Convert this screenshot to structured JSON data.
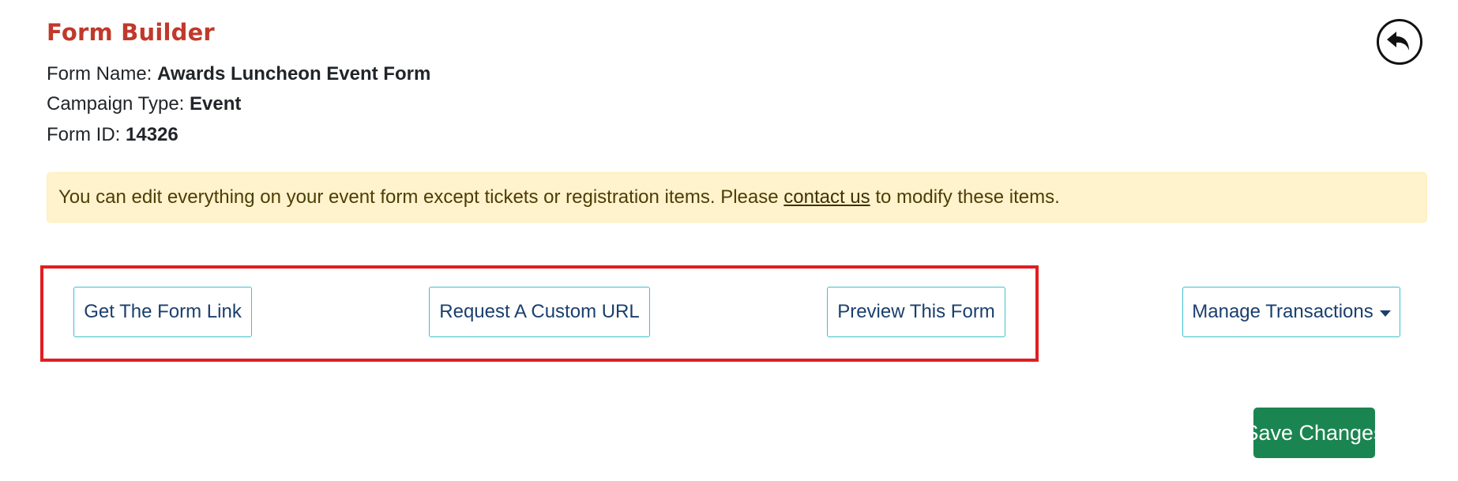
{
  "header": {
    "title": "Form Builder",
    "form_name_label": "Form Name:",
    "form_name_value": "Awards Luncheon Event Form",
    "campaign_type_label": "Campaign Type:",
    "campaign_type_value": "Event",
    "form_id_label": "Form ID:",
    "form_id_value": "14326",
    "back_icon": "undo-arrow-icon"
  },
  "alert": {
    "text_before": "You can edit everything on your event form except tickets or registration items. Please ",
    "link_text": "contact us",
    "text_after": " to modify these items."
  },
  "actions": {
    "get_link": "Get The Form Link",
    "custom_url": "Request A Custom URL",
    "preview": "Preview This Form",
    "manage": "Manage Transactions"
  },
  "footer": {
    "save": "Save Changes"
  },
  "colors": {
    "title": "#c0392b",
    "alert_bg": "#fff3cd",
    "button_border": "#3dbfcf",
    "highlight": "#e01e22",
    "save_bg": "#1a8550"
  }
}
